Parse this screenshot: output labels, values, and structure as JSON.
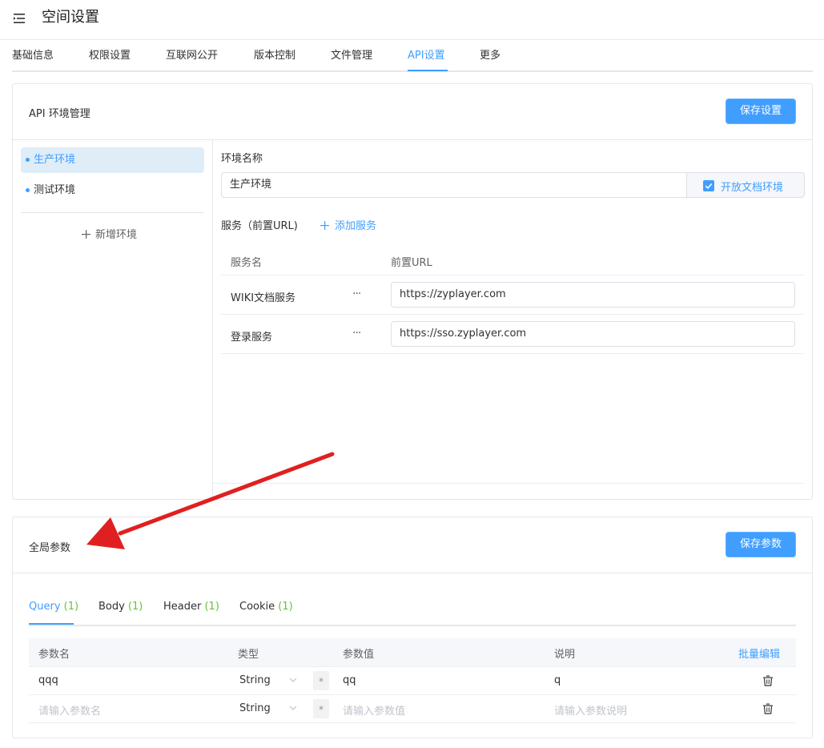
{
  "header": {
    "title": "空间设置",
    "menu_icon": "menu-fold-icon"
  },
  "tabs": [
    "基础信息",
    "权限设置",
    "互联网公开",
    "版本控制",
    "文件管理",
    "API设置",
    "更多"
  ],
  "active_tab": "API设置",
  "env_card": {
    "title": "API 环境管理",
    "save_button": "保存设置",
    "environments": [
      {
        "label": "生产环境",
        "active": true
      },
      {
        "label": "测试环境",
        "active": false
      }
    ],
    "add_env": "新增环境",
    "env_name_label": "环境名称",
    "env_name_value": "生产环境",
    "open_doc_label": "开放文档环境",
    "open_doc_checked": true,
    "services_label": "服务（前置URL)",
    "add_service": "添加服务",
    "services_header": {
      "name": "服务名",
      "url": "前置URL"
    },
    "services": [
      {
        "name": "WIKI文档服务",
        "url": "https://zyplayer.com"
      },
      {
        "name": "登录服务",
        "url": "https://sso.zyplayer.com"
      }
    ],
    "more_symbol": "···"
  },
  "param_card": {
    "title": "全局参数",
    "save_button": "保存参数",
    "tabs": [
      {
        "label": "Query",
        "count": "(1)"
      },
      {
        "label": "Body",
        "count": "(1)"
      },
      {
        "label": "Header",
        "count": "(1)"
      },
      {
        "label": "Cookie",
        "count": "(1)"
      }
    ],
    "columns": {
      "name": "参数名",
      "type": "类型",
      "value": "参数值",
      "desc": "说明",
      "batch": "批量编辑"
    },
    "rows": [
      {
        "name": "qqq",
        "type": "String",
        "value": "qq",
        "desc": "q",
        "required": "*"
      }
    ],
    "new_row": {
      "name_placeholder": "请输入参数名",
      "type": "String",
      "value_placeholder": "请输入参数值",
      "desc_placeholder": "请输入参数说明",
      "required": "*"
    }
  },
  "colors": {
    "primary": "#409eff",
    "count_green": "#67c23a",
    "arrow": "#e02020"
  }
}
